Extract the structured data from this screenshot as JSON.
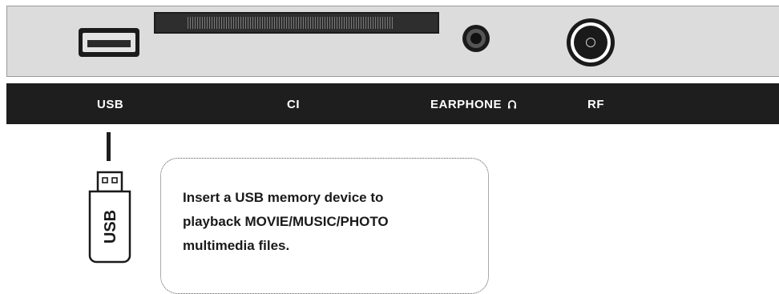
{
  "labels": {
    "usb": "USB",
    "ci": "CI",
    "earphone": "EARPHONE",
    "rf": "RF"
  },
  "usb_stick": {
    "label": "USB"
  },
  "callout": {
    "lines": [
      "Insert a USB memory device to",
      "playback MOVIE/MUSIC/PHOTO",
      "multimedia files."
    ]
  },
  "icons": {
    "earphone_label_icon": "headphone-icon"
  },
  "colors": {
    "label_bar": "#1e1e1e",
    "panel": "#dcdcdc"
  }
}
